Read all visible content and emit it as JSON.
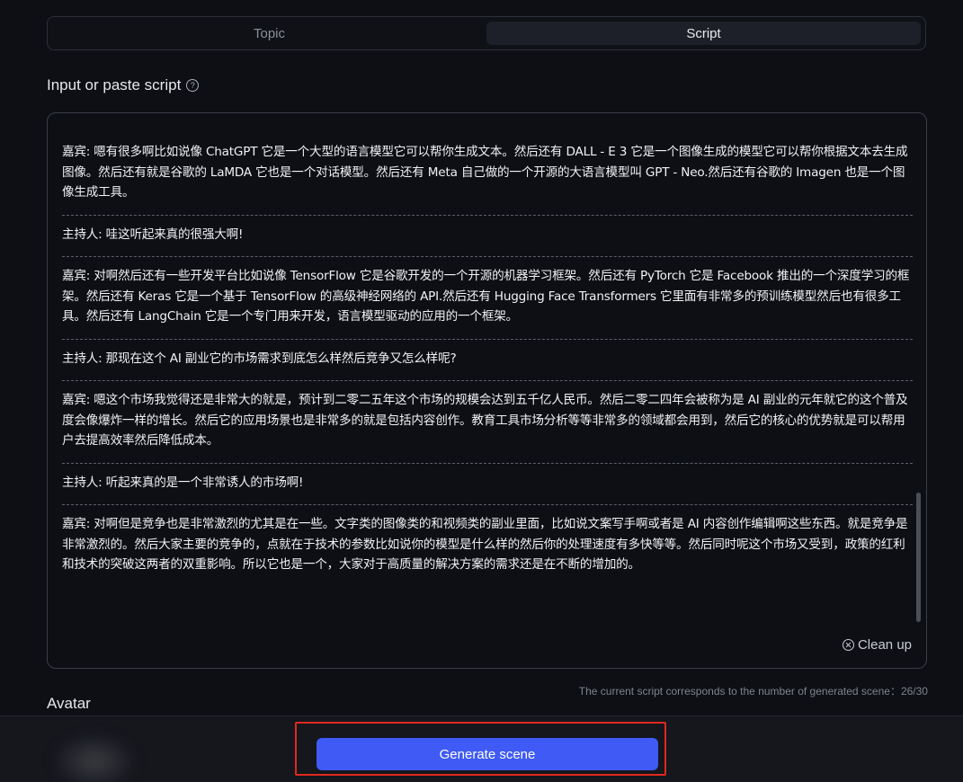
{
  "tabs": [
    {
      "label": "Topic",
      "active": false
    },
    {
      "label": "Script",
      "active": true
    }
  ],
  "script_section": {
    "label": "Input or paste script",
    "help_icon": "question-circle-icon"
  },
  "script_segments": [
    "嘉宾: 嗯有很多啊比如说像 ChatGPT 它是一个大型的语言模型它可以帮你生成文本。然后还有 DALL - E 3 它是一个图像生成的模型它可以帮你根据文本去生成图像。然后还有就是谷歌的 LaMDA 它也是一个对话模型。然后还有 Meta 自己做的一个开源的大语言模型叫 GPT - Neo.然后还有谷歌的 Imagen 也是一个图像生成工具。",
    "主持人: 哇这听起来真的很强大啊!",
    "嘉宾: 对啊然后还有一些开发平台比如说像 TensorFlow 它是谷歌开发的一个开源的机器学习框架。然后还有 PyTorch 它是 Facebook 推出的一个深度学习的框架。然后还有 Keras 它是一个基于 TensorFlow 的高级神经网络的 API.然后还有 Hugging Face Transformers 它里面有非常多的预训练模型然后也有很多工具。然后还有 LangChain 它是一个专门用来开发，语言模型驱动的应用的一个框架。",
    "主持人: 那现在这个 AI 副业它的市场需求到底怎么样然后竞争又怎么样呢?",
    "嘉宾: 嗯这个市场我觉得还是非常大的就是，预计到二零二五年这个市场的规模会达到五千亿人民币。然后二零二四年会被称为是 AI 副业的元年就它的这个普及度会像爆炸一样的增长。然后它的应用场景也是非常多的就是包括内容创作。教育工具市场分析等等非常多的领域都会用到，然后它的核心的优势就是可以帮用户去提高效率然后降低成本。",
    "主持人: 听起来真的是一个非常诱人的市场啊!",
    "嘉宾: 对啊但是竞争也是非常激烈的尤其是在一些。文字类的图像类的和视频类的副业里面，比如说文案写手啊或者是 AI 内容创作编辑啊这些东西。就是竞争是非常激烈的。然后大家主要的竞争的，点就在于技术的参数比如说你的模型是什么样的然后你的处理速度有多快等等。然后同时呢这个市场又受到，政策的红利和技术的突破这两者的双重影响。所以它也是一个，大家对于高质量的解决方案的需求还是在不断的增加的。"
  ],
  "cleanup": {
    "label": "Clean up",
    "icon": "x-circle-icon"
  },
  "scene_count_text": "The current script corresponds to the number of generated scene：26/30",
  "avatar_section": {
    "label": "Avatar"
  },
  "generate_button": {
    "label": "Generate scene"
  },
  "colors": {
    "primary": "#3f5af5",
    "highlight": "#e0281f",
    "background": "#0d0f14"
  }
}
